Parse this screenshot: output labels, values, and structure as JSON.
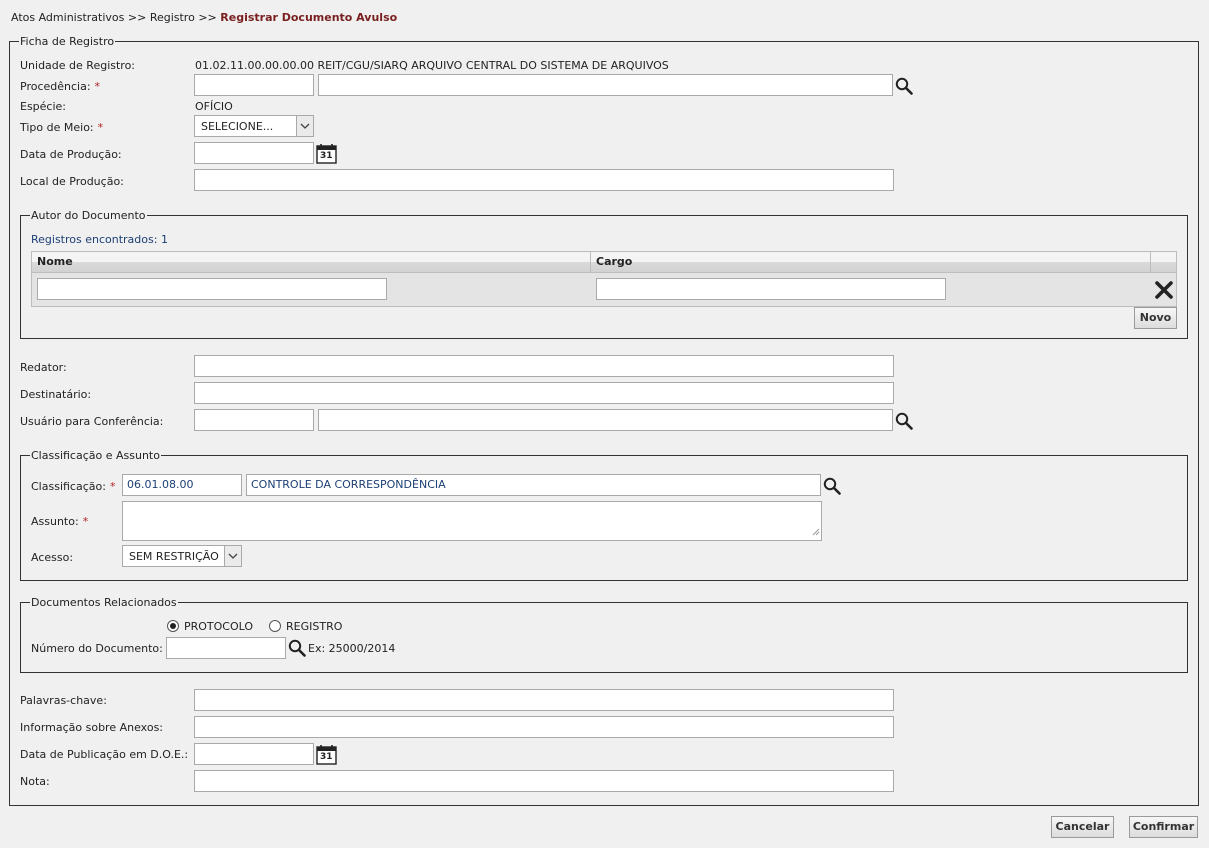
{
  "breadcrumb": {
    "item1": "Atos Administrativos",
    "sep1": ">>",
    "item2": "Registro",
    "sep2": ">>",
    "current": "Registrar Documento Avulso"
  },
  "ficha": {
    "legend": "Ficha de Registro",
    "unidade_label": "Unidade de Registro:",
    "unidade_value": "01.02.11.00.00.00.00 REIT/CGU/SIARQ ARQUIVO CENTRAL DO SISTEMA DE ARQUIVOS",
    "procedencia_label": "Procedência:",
    "especie_label": "Espécie:",
    "especie_value": "OFÍCIO",
    "tipo_meio_label": "Tipo de Meio:",
    "tipo_meio_value": "SELECIONE...",
    "data_producao_label": "Data de Produção:",
    "local_producao_label": "Local de Produção:",
    "required_mark": "*",
    "calendar_day": "31"
  },
  "autor": {
    "legend": "Autor do Documento",
    "registros": "Registros encontrados: 1",
    "col_nome": "Nome",
    "col_cargo": "Cargo",
    "novo_label": "Novo"
  },
  "pessoas": {
    "redator_label": "Redator:",
    "destinatario_label": "Destinatário:",
    "usuario_label": "Usuário para Conferência:"
  },
  "classificacao": {
    "legend": "Classificação e Assunto",
    "classificacao_label": "Classificação:",
    "codigo_value": "06.01.08.00",
    "descricao_value": "CONTROLE DA CORRESPONDÊNCIA",
    "assunto_label": "Assunto:",
    "acesso_label": "Acesso:",
    "acesso_value": "SEM RESTRIÇÃO"
  },
  "relacionados": {
    "legend": "Documentos Relacionados",
    "radio_protocolo": "PROTOCOLO",
    "radio_registro": "REGISTRO",
    "numero_label": "Número do Documento:",
    "example": "Ex: 25000/2014"
  },
  "extras": {
    "palavras_label": "Palavras-chave:",
    "anexos_label": "Informação sobre Anexos:",
    "data_publicacao_label": "Data de Publicação em D.O.E.:",
    "nota_label": "Nota:"
  },
  "actions": {
    "cancelar": "Cancelar",
    "confirmar": "Confirmar"
  },
  "colors": {
    "breadcrumb_current": "#7a1f1f",
    "required": "#b22222",
    "link_blue": "#1c3f75"
  }
}
